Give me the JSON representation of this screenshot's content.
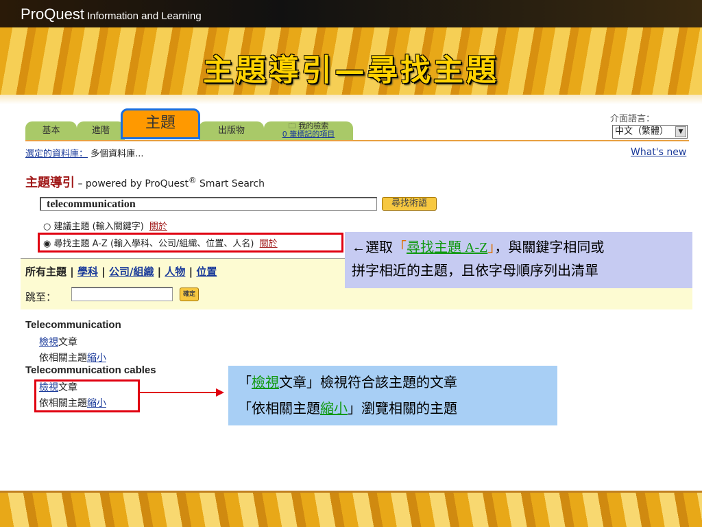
{
  "header": {
    "brand": "ProQuest",
    "brand_sub": "Information and Learning",
    "slide_title": "主題導引—尋找主題"
  },
  "tabs": [
    {
      "label": "基本"
    },
    {
      "label": "進階"
    },
    {
      "label": "主題"
    },
    {
      "label": "出版物"
    },
    {
      "label": "我的檢索",
      "sub": "0 筆標記的項目"
    }
  ],
  "language": {
    "label": "介面語言：",
    "value": "中文（繁體）",
    "whats_new": "What's new"
  },
  "database": {
    "label": "選定的資料庫：",
    "value": "多個資料庫..."
  },
  "guide": {
    "title": "主題導引",
    "powered": " – powered by ProQuest",
    "reg": "®",
    "powered2": " Smart Search"
  },
  "search": {
    "value": "telecommunication",
    "button": "尋找術語"
  },
  "options": [
    {
      "label": "建議主題 (輸入關鍵字)",
      "about": "關於",
      "checked": false
    },
    {
      "label": "尋找主題 A-Z (輸入學科、公司/組織、位置、人名)",
      "about": "關於",
      "checked": true
    }
  ],
  "filters": {
    "all": "所有主題",
    "sep": "|",
    "items": [
      "學科",
      "公司/組織",
      "人物",
      "位置"
    ]
  },
  "jump": {
    "label": "跳至：",
    "button": "確定"
  },
  "results": [
    {
      "title": "Telecommunication",
      "view_link": "檢視",
      "view_text": "文章",
      "narrow_text": "依相關主題",
      "narrow_link": "縮小"
    },
    {
      "title": "Telecommunication cables",
      "view_link": "檢視",
      "view_text": "文章",
      "narrow_text": "依相關主題",
      "narrow_link": "縮小"
    }
  ],
  "callout1": {
    "pre": "←選取",
    "q1": "「",
    "link": "尋找主題 A-Z",
    "q2": "」",
    "post": "，與關鍵字相同或",
    "line2": "拼字相近的主題，且依字母順序列出清單"
  },
  "callout2": {
    "l1_q1": "「",
    "l1_link": "檢視",
    "l1_post": "文章」檢視符合該主題的文章",
    "l2_pre": "「依相關主題",
    "l2_link": "縮小",
    "l2_post": "」瀏覽相關的主題"
  }
}
